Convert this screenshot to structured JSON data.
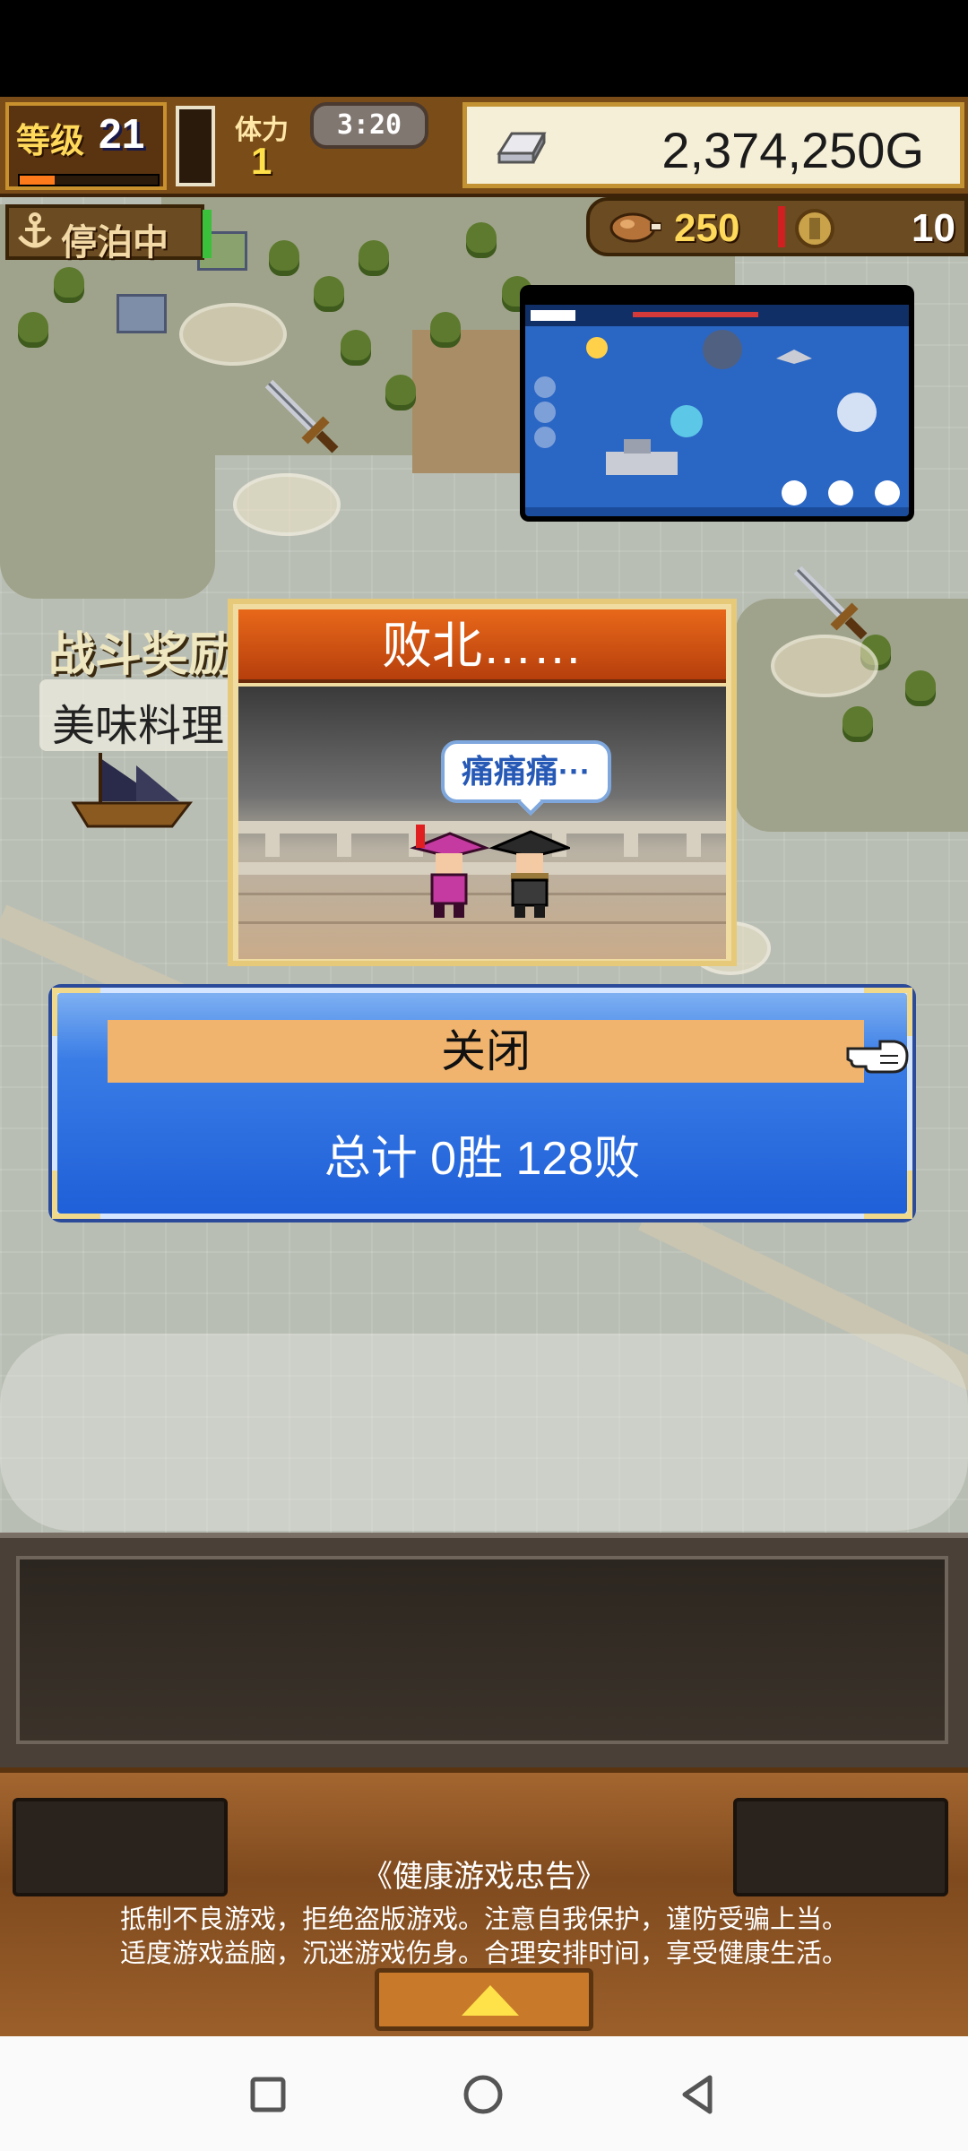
{
  "hud": {
    "level_label": "等级",
    "level_value": "21",
    "xp_fraction": 0.25,
    "crew_label": "体力",
    "crew_value": "1",
    "timer": "3:20",
    "gold": "2,374,250G"
  },
  "status": {
    "anchored_label": "停泊中"
  },
  "resources": {
    "food": "250",
    "coins": "10"
  },
  "map": {
    "battle_reward_label": "战斗奖励",
    "delicious_label": "美味料理"
  },
  "defeat_dialog": {
    "title": "败北……",
    "speech": "痛痛痛···"
  },
  "result_panel": {
    "close_label": "关闭",
    "summary": "总计 0胜 128败"
  },
  "health_notice": {
    "title": "《健康游戏忠告》",
    "line1": "抵制不良游戏，拒绝盗版游戏。注意自我保护，谨防受骗上当。",
    "line2": "适度游戏益脑，沉迷游戏伤身。合理安排时间，享受健康生活。"
  },
  "colors": {
    "accent_blue": "#1f5fd8",
    "close_button": "#f0b46e",
    "defeat_bar": "#e8681a"
  },
  "icons": [
    "anchor-icon",
    "silver-bar-icon",
    "food-icon",
    "coin-icon",
    "sword-icon",
    "hand-pointer-icon",
    "up-arrow-icon",
    "square-icon",
    "circle-icon",
    "back-triangle-icon"
  ]
}
